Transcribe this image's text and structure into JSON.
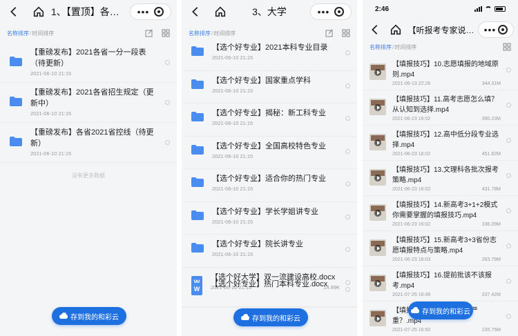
{
  "panel1": {
    "title": "1、【置顶】各省…",
    "sort_active": "名称排序",
    "sort_sep": "/",
    "sort_inactive": "时间排序",
    "items": [
      {
        "name": "【重磅发布】2021各省一分一段表（待更新）",
        "date": "2021-06-10 21:15",
        "size": ""
      },
      {
        "name": "【重磅发布】2021各省招生规定（更新中）",
        "date": "2021-06-10 21:15",
        "size": ""
      },
      {
        "name": "【重磅发布】各省2021省控线（待更新）",
        "date": "2021-06-10 21:15",
        "size": ""
      }
    ],
    "no_more": "没有更多数据",
    "save_button": "存到我的和彩云"
  },
  "panel2": {
    "title": "3、大学",
    "sort_active": "名称排序",
    "sort_sep": "/",
    "sort_inactive": "时间排序",
    "items": [
      {
        "name": "【选个好专业】2021本科专业目录",
        "date": "2021-06-10 21:15",
        "size": "",
        "icon": "folder"
      },
      {
        "name": "【选个好专业】国家重点学科",
        "date": "2021-06-10 21:15",
        "size": "",
        "icon": "folder"
      },
      {
        "name": "【选个好专业】揭秘：新工科专业",
        "date": "2021-06-10 21:15",
        "size": "",
        "icon": "folder"
      },
      {
        "name": "【选个好专业】全国高校特色专业",
        "date": "2021-06-10 21:15",
        "size": "",
        "icon": "folder"
      },
      {
        "name": "【选个好专业】适合你的热门专业",
        "date": "2021-06-10 21:15",
        "size": "",
        "icon": "folder"
      },
      {
        "name": "【选个好专业】学长学姐讲专业",
        "date": "2021-06-10 21:15",
        "size": "",
        "icon": "folder"
      },
      {
        "name": "【选个好专业】院长讲专业",
        "date": "2021-06-10 21:15",
        "size": "",
        "icon": "folder"
      },
      {
        "name": "【选个好大学】双一流建设高校.docx",
        "date": "2021-06-10 21:15",
        "size": "14.99K",
        "icon": "word"
      },
      {
        "name": "【选个好专业】热门本科专业.docx",
        "date": "",
        "size": "",
        "icon": "word"
      }
    ],
    "save_button": "存到我的和彩云"
  },
  "panel3": {
    "status_time": "2:46",
    "title": "【听报考专家说…",
    "sort_active": "名称排序",
    "sort_sep": "/",
    "sort_inactive": "时间排序",
    "items": [
      {
        "name": "【填报技巧】10.志愿填报的地域原则.mp4",
        "date": "2021-06-13 22:26",
        "size": "344.31M"
      },
      {
        "name": "【填报技巧】11.高考志愿怎么填？从认知到选择.mp4",
        "date": "2021-06-23 16:02",
        "size": "390.23M"
      },
      {
        "name": "【填报技巧】12.高中低分段专业选择.mp4",
        "date": "2021-06-23 16:02",
        "size": "451.82M"
      },
      {
        "name": "【填报技巧】13.文理科各批次报考策略.mp4",
        "date": "2021-06-23 16:02",
        "size": "431.78M"
      },
      {
        "name": "【填报技巧】14.新高考3+1+2模式你需要掌握的填报技巧.mp4",
        "date": "2021-06-23 16:02",
        "size": "336.09M"
      },
      {
        "name": "【填报技巧】15.新高考3+3省份志愿填报特点与策略.mp4",
        "date": "2021-06-23 16:03",
        "size": "283.79M"
      },
      {
        "name": "【填报技巧】16.提前批该不该报考.mp4",
        "date": "2021-07-25 16:49",
        "size": "237.42M"
      },
      {
        "name": "【填报技巧】17.哪一个更严重？.mp4",
        "date": "2021-07-25 16:50",
        "size": "235.75M"
      }
    ],
    "save_button": "存到我的和彩云"
  },
  "colors": {
    "accent": "#3a7be8",
    "button": "#1e6fe0",
    "folder": "#4a8cf0"
  }
}
